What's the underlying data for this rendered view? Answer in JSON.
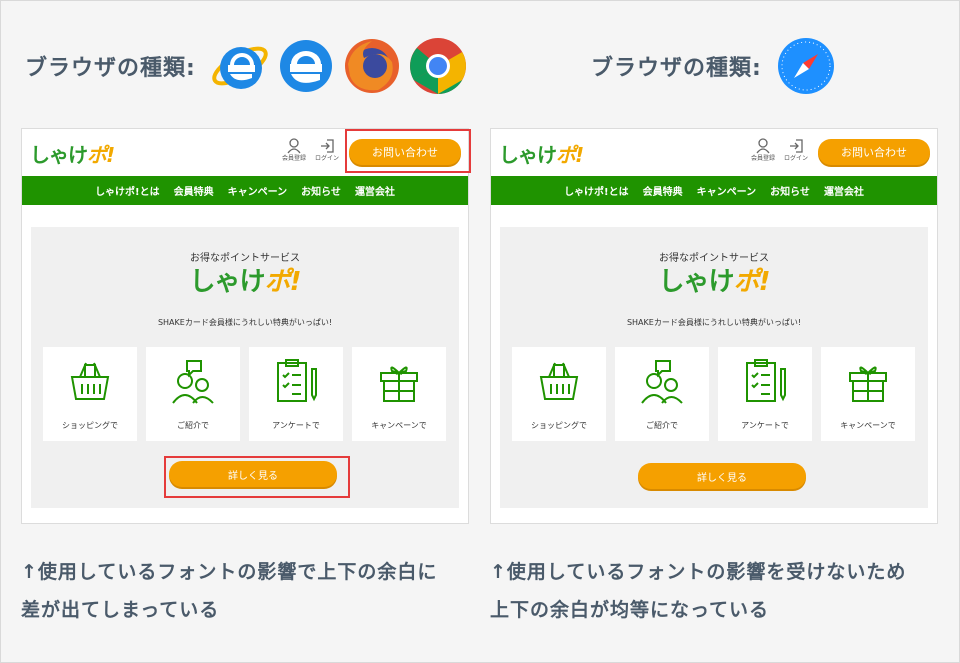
{
  "left": {
    "browser_label": "ブラウザの種類:",
    "browsers": [
      "internet-explorer-icon",
      "edge-icon",
      "firefox-icon",
      "chrome-icon"
    ],
    "caption_line1": "↑使用しているフォントの影響で上下の余白に",
    "caption_line2": "差が出てしまっている"
  },
  "right": {
    "browser_label": "ブラウザの種類:",
    "browsers": [
      "safari-icon"
    ],
    "caption_line1": "↑使用しているフォントの影響を受けないため",
    "caption_line2": "上下の余白が均等になっている"
  },
  "site": {
    "logo_main": "しゃけ",
    "logo_po": "ポ",
    "logo_ex": "!",
    "member_label": "会員登録",
    "login_label": "ログイン",
    "contact_button": "お問い合わせ",
    "nav": [
      "しゃけポ!とは",
      "会員特典",
      "キャンペーン",
      "お知らせ",
      "運営会社"
    ],
    "subhead": "お得なポイントサービス",
    "tagline": "SHAKEカード会員様にうれしい特典がいっぱい!",
    "cards": [
      "ショッピングで",
      "ご紹介で",
      "アンケートで",
      "キャンペーンで"
    ],
    "more_button": "詳しく見る"
  },
  "colors": {
    "green": "#1f9300",
    "orange": "#f5a000",
    "highlight": "#e53b3b"
  }
}
